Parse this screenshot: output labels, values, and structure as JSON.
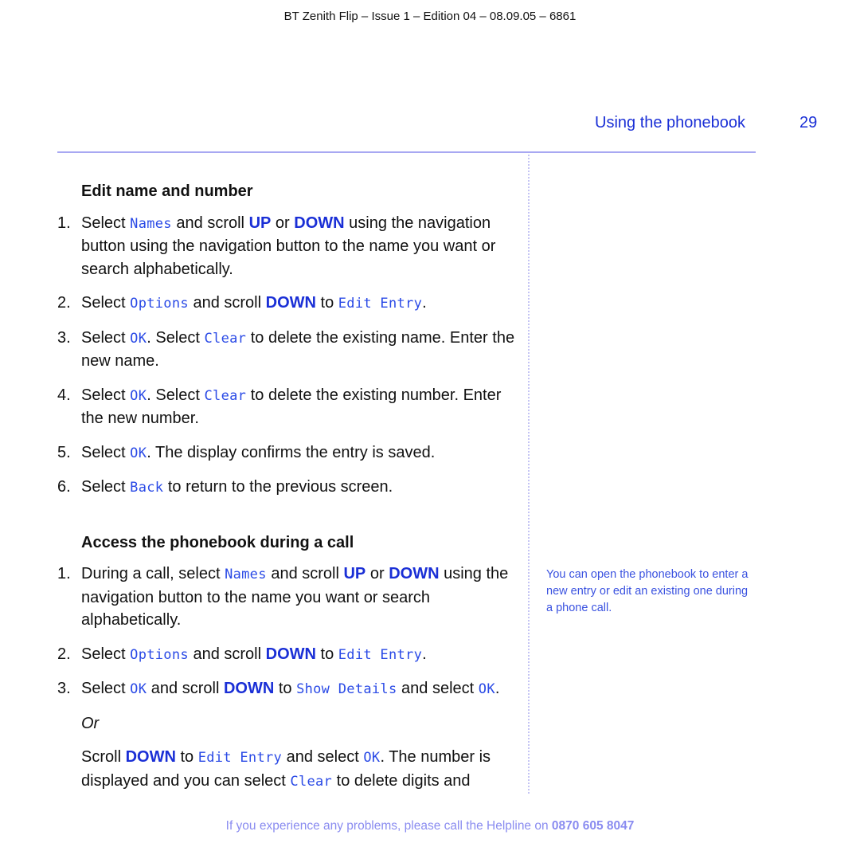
{
  "header": {
    "doc_info": "BT Zenith Flip – Issue 1 – Edition 04 – 08.09.05 – 6861",
    "section_title": "Using the phonebook",
    "page_number": "29"
  },
  "colors": {
    "accent": "#1a2fd6",
    "lcd_text": "#2a4ae6",
    "rule": "#a8a8f2",
    "footer": "#8a8cf0"
  },
  "sections": [
    {
      "heading": "Edit name and number",
      "steps": [
        {
          "num": "1.",
          "parts": [
            "Select ",
            "Names",
            " and scroll ",
            "UP",
            " or ",
            "DOWN",
            " using the navigation button using the navigation button to the name you want or search alphabetically."
          ]
        },
        {
          "num": "2.",
          "parts": [
            "Select ",
            "Options",
            " and scroll ",
            "DOWN",
            " to ",
            "Edit Entry",
            "."
          ]
        },
        {
          "num": "3.",
          "parts": [
            "Select ",
            "OK",
            ". Select ",
            "Clear",
            " to delete the existing name. Enter the new name."
          ]
        },
        {
          "num": "4.",
          "parts": [
            "Select ",
            "OK",
            ". Select ",
            "Clear",
            " to delete the existing number. Enter the new number."
          ]
        },
        {
          "num": "5.",
          "parts": [
            "Select ",
            "OK",
            ". The display confirms the entry is saved."
          ]
        },
        {
          "num": "6.",
          "parts": [
            "Select ",
            "Back",
            " to return to the previous screen."
          ]
        }
      ]
    },
    {
      "heading": "Access the phonebook during a call",
      "steps": [
        {
          "num": "1.",
          "parts": [
            "During a call, select ",
            "Names",
            " and scroll ",
            "UP",
            " or ",
            "DOWN",
            " using the navigation button to the name you want or search alphabetically."
          ]
        },
        {
          "num": "2.",
          "parts": [
            "Select ",
            "Options",
            " and scroll ",
            "DOWN",
            " to ",
            "Edit Entry",
            "."
          ]
        },
        {
          "num": "3.",
          "parts": [
            "Select ",
            "OK",
            " and scroll ",
            "DOWN",
            " to ",
            "Show Details",
            " and select ",
            "OK",
            "."
          ]
        }
      ],
      "or_label": "Or",
      "continuation": [
        "Scroll ",
        "DOWN",
        " to ",
        "Edit Entry",
        " and select ",
        "OK",
        ". The number is displayed and you can select ",
        "Clear",
        " to delete digits and"
      ]
    }
  ],
  "sidenote": "You can open the phonebook to enter a new entry or edit an existing one during a phone call.",
  "footer": {
    "text": "If you experience any problems, please call the Helpline on ",
    "phone": "0870 605 8047"
  }
}
